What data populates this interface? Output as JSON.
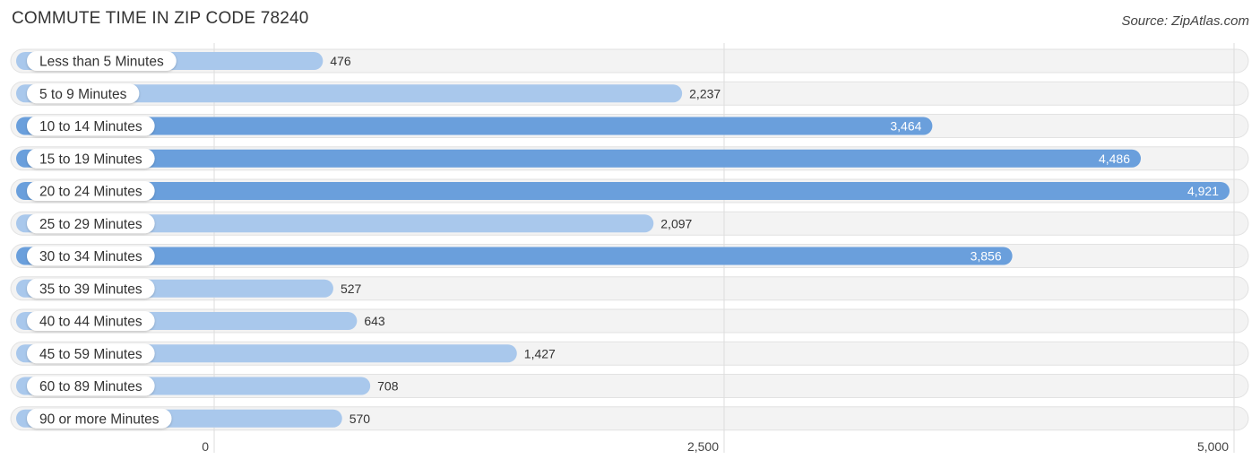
{
  "header": {
    "title": "COMMUTE TIME IN ZIP CODE 78240",
    "source": "Source: ZipAtlas.com"
  },
  "colors": {
    "bar_light": "#a9c8ec",
    "bar_dark": "#6a9fdc",
    "track": "#f3f3f3",
    "grid": "#dddddd"
  },
  "chart_data": {
    "type": "bar",
    "orientation": "horizontal",
    "title": "COMMUTE TIME IN ZIP CODE 78240",
    "xlabel": "",
    "ylabel": "",
    "xlim": [
      0,
      5000
    ],
    "x_ticks": [
      0,
      2500,
      5000
    ],
    "x_tick_labels": [
      "0",
      "2,500",
      "5,000"
    ],
    "grid": true,
    "categories": [
      "Less than 5 Minutes",
      "5 to 9 Minutes",
      "10 to 14 Minutes",
      "15 to 19 Minutes",
      "20 to 24 Minutes",
      "25 to 29 Minutes",
      "30 to 34 Minutes",
      "35 to 39 Minutes",
      "40 to 44 Minutes",
      "45 to 59 Minutes",
      "60 to 89 Minutes",
      "90 or more Minutes"
    ],
    "values": [
      476,
      2237,
      3464,
      4486,
      4921,
      2097,
      3856,
      527,
      643,
      1427,
      708,
      570
    ],
    "value_labels": [
      "476",
      "2,237",
      "3,464",
      "4,486",
      "4,921",
      "2,097",
      "3,856",
      "527",
      "643",
      "1,427",
      "708",
      "570"
    ]
  }
}
